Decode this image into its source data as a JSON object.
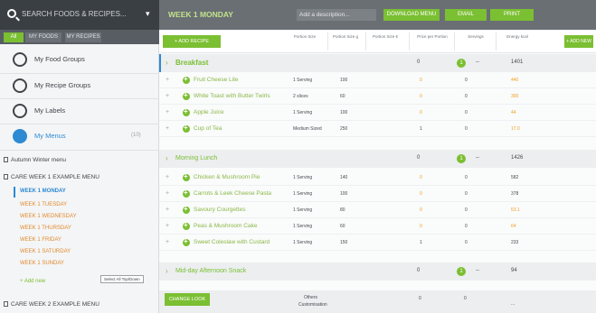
{
  "sidebar": {
    "search_placeholder": "SEARCH FOODS & RECIPES...",
    "tabs": [
      "All",
      "MY FOODS",
      "MY RECIPES"
    ],
    "items": [
      {
        "label": "My Food Groups",
        "icon": "food-group-icon"
      },
      {
        "label": "My Recipe Groups",
        "icon": "recipe-group-icon"
      },
      {
        "label": "My Labels",
        "icon": "label-icon"
      },
      {
        "label": "My Menus",
        "icon": "menu-icon",
        "meta": "(10)"
      }
    ],
    "menus": [
      {
        "label": "Autumn Winter menu"
      },
      {
        "label": "CARE WEEK 1 EXAMPLE MENU"
      }
    ],
    "days": [
      "WEEK 1 MONDAY",
      "WEEK 1 TUESDAY",
      "WEEK 1 WEDNESDAY",
      "WEEK 1 THURSDAY",
      "WEEK 1 FRIDAY",
      "WEEK 1 SATURDAY",
      "WEEK 1 SUNDAY"
    ],
    "more_label": "+ Add new",
    "last_menu": "CARE WEEK 2 EXAMPLE MENU"
  },
  "topbar": {
    "title": "WEEK 1 MONDAY",
    "description": "Add a description...",
    "btn_download": "DOWNLOAD MENU",
    "btn_email": "EMAIL",
    "btn_print": "PRINT"
  },
  "header": {
    "add_button": "+ ADD RECIPE",
    "columns": [
      "Portion Size",
      "Portion Size g",
      "Portion Size €",
      "Price per Portion",
      "Servings",
      "Energy kcal"
    ],
    "new_button": "+ ADD NEW"
  },
  "sections": [
    {
      "name": "Breakfast",
      "col1": "0",
      "badge": "1",
      "col3": "--",
      "energy": "1401",
      "rows": [
        {
          "name": "Fruit Cheese Lite",
          "portion": "1 Serving",
          "g": "100",
          "price": "0",
          "servings": "0",
          "energy": "440"
        },
        {
          "name": "White Toast with Butter Twirls",
          "portion": "2 slices",
          "g": "60",
          "price": "0",
          "servings": "0",
          "energy": "300"
        },
        {
          "name": "Apple Juice",
          "portion": "1 Serving",
          "g": "100",
          "price": "0",
          "servings": "0",
          "energy": "44"
        },
        {
          "name": "Cup of Tea",
          "portion": "Medium Sized",
          "g": "250",
          "price": "1",
          "servings": "0",
          "energy": "17.0"
        }
      ]
    },
    {
      "name": "Morning Lunch",
      "col1": "0",
      "badge": "1",
      "col3": "--",
      "energy": "1426",
      "rows": [
        {
          "name": "Chicken & Mushroom Pie",
          "portion": "1 Serving",
          "g": "140",
          "price": "0",
          "servings": "0",
          "energy": "582"
        },
        {
          "name": "Carrots & Leek Cheese Pasta",
          "portion": "1 Serving",
          "g": "100",
          "price": "0",
          "servings": "0",
          "energy": "378"
        },
        {
          "name": "Savoury Courgettes",
          "portion": "1 Serving",
          "g": "80",
          "price": "0",
          "servings": "0",
          "energy": "53.1"
        },
        {
          "name": "Peas & Mushroom Cake",
          "portion": "1 Serving",
          "g": "60",
          "price": "0",
          "servings": "0",
          "energy": "64"
        },
        {
          "name": "Sweet Coleslaw with Custard",
          "portion": "1 Serving",
          "g": "150",
          "price": "1",
          "servings": "0",
          "energy": "233"
        }
      ]
    },
    {
      "name": "Mid-day Afternoon Snack",
      "col1": "0",
      "badge": "1",
      "col3": "--",
      "energy": "94"
    }
  ],
  "footer": {
    "button": "CHANGE LOOK",
    "label": "Others",
    "sub": "Customisation",
    "v1": "0",
    "v2": "0",
    "v3": "..."
  },
  "tooltip": "Select All Top/Down"
}
